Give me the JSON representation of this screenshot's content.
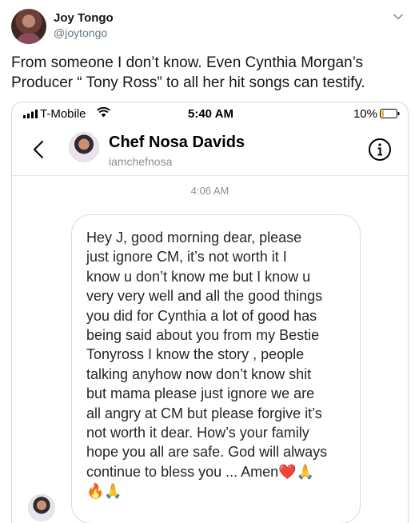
{
  "tweet": {
    "author": {
      "display_name": "Joy Tongo",
      "handle": "@joytongo"
    },
    "text_lines": [
      "From someone I don’t know. Even Cynthia Morgan’s",
      "Producer “ Tony Ross” to all her hit songs can testify."
    ],
    "menu_icon": "chevron-down-icon"
  },
  "phone": {
    "status_bar": {
      "carrier": "T-Mobile",
      "time": "5:40 AM",
      "battery": "10%"
    },
    "chat_header": {
      "contact_name": "Chef Nosa Davids",
      "contact_handle": "iamchefnosa",
      "back_icon": "back-arrow-icon",
      "info_icon": "info-icon"
    },
    "timestamp": "4:06 AM",
    "message_lines": [
      "Hey J, good morning dear, please",
      "just ignore CM, it’s not worth it I",
      "know u don’t know me but I know u",
      "very very well and all the good things",
      "you did for Cynthia a lot of good has",
      "being said about you from my Bestie",
      "Tonyross I know the story , people",
      "talking anyhow now don’t know shit",
      "but mama please just ignore we are",
      "all angry at CM but please forgive it’s",
      "not worth it dear. How’s your family",
      "hope you all are safe. God will always",
      "continue to bless you ... Amen❤️🙏",
      "🔥🙏"
    ]
  },
  "colors": {
    "text_primary": "#14171a",
    "text_secondary": "#657786",
    "bubble_border": "#dbdbdb",
    "card_border": "#cfd9de"
  }
}
